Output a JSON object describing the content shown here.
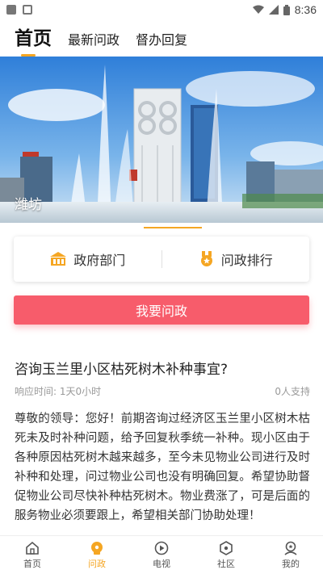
{
  "status_bar": {
    "time": "8:36",
    "icons": [
      "gallery-icon",
      "app-a-icon",
      "wifi-icon",
      "signal-icon",
      "battery-icon"
    ]
  },
  "top_tabs": [
    {
      "label": "首页",
      "active": true
    },
    {
      "label": "最新问政",
      "active": false
    },
    {
      "label": "督办回复",
      "active": false
    }
  ],
  "banner": {
    "caption": "潍坊"
  },
  "quick_links": {
    "gov_departments": "政府部门",
    "ranking": "问政排行"
  },
  "ask_button": "我要问政",
  "question": {
    "title": "咨询玉兰里小区枯死树木补种事宜?",
    "time_label": "响应时间: 1天0小时",
    "support": "0人支持",
    "body": "尊敬的领导：您好！前期咨询过经济区玉兰里小区树木枯死未及时补种问题，给予回复秋季统一补种。现小区由于各种原因枯死树木越来越多，至今未见物业公司进行及时补种和处理，问过物业公司也没有明确回复。希望协助督促物业公司尽快补种枯死树木。物业费涨了，可是后面的服务物业必须要跟上，希望相关部门协助处理！"
  },
  "bottom_nav": [
    {
      "label": "首页",
      "icon": "home-icon",
      "active": false
    },
    {
      "label": "问政",
      "icon": "ask-icon",
      "active": true
    },
    {
      "label": "电视",
      "icon": "play-icon",
      "active": false
    },
    {
      "label": "社区",
      "icon": "community-icon",
      "active": false
    },
    {
      "label": "我的",
      "icon": "profile-icon",
      "active": false
    }
  ],
  "colors": {
    "accent": "#f5a623",
    "ask_button": "#f75c6b"
  }
}
